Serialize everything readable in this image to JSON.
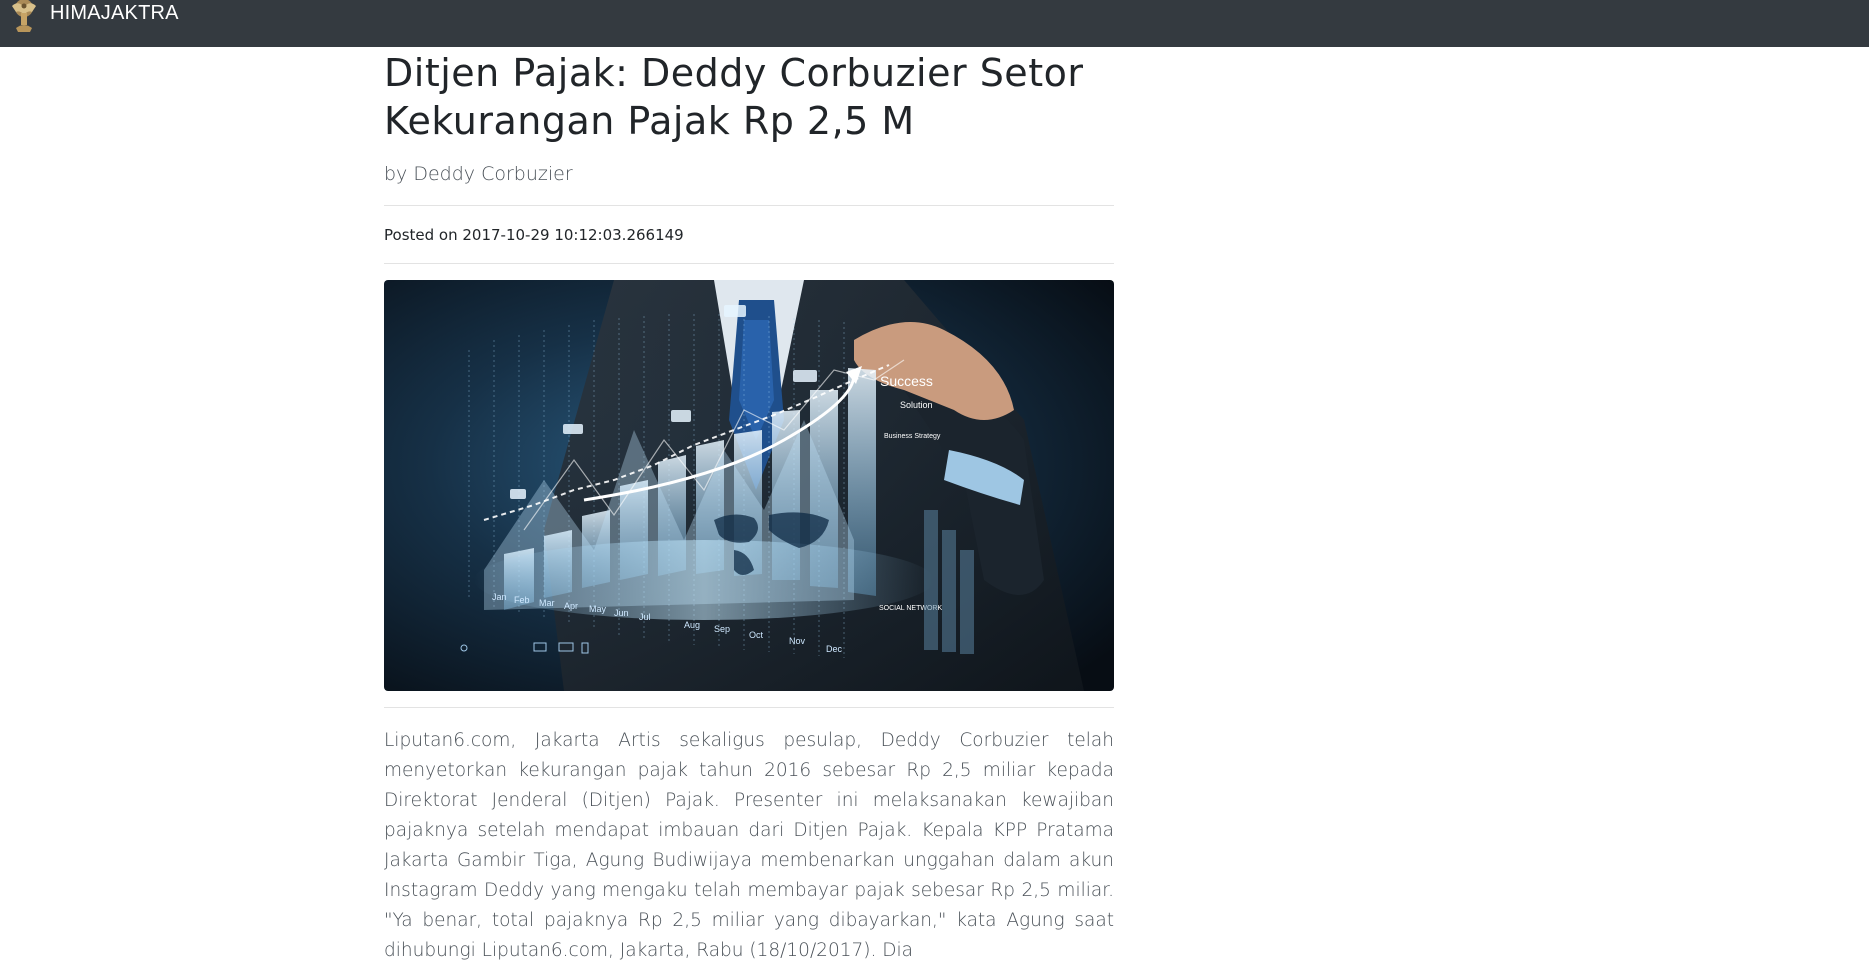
{
  "navbar": {
    "brand_name": "HIMAJAKTRA",
    "logo_icon": "eagle-emblem-icon",
    "background": "#343a40"
  },
  "post": {
    "title": "Ditjen Pajak: Deddy Corbuzier Setor Kekurangan Pajak Rp 2,5 M",
    "by_prefix": "by",
    "author": "Deddy Corbuzier",
    "posted_prefix": "Posted on",
    "posted_datetime": "2017-10-29 10:12:03.266149",
    "hero_image": {
      "kind": "business-growth-chart-illustration",
      "labels": [
        "Success",
        "Solution",
        "Business Strategy",
        "SOCIAL NETWORK"
      ],
      "months": [
        "Jan",
        "Feb",
        "Mar",
        "Apr",
        "May",
        "Jun",
        "Jul",
        "Aug",
        "Sep",
        "Oct",
        "Nov",
        "Dec"
      ]
    },
    "body": "Liputan6.com, Jakarta Artis sekaligus pesulap, Deddy Corbuzier telah menyetorkan kekurangan pajak tahun 2016 sebesar Rp 2,5 miliar kepada Direktorat Jenderal (Ditjen) Pajak. Presenter ini melaksanakan kewajiban pajaknya setelah mendapat imbauan dari Ditjen Pajak. Kepala KPP Pratama Jakarta Gambir Tiga, Agung Budiwijaya membenarkan unggahan dalam akun Instagram Deddy yang mengaku telah membayar pajak sebesar Rp 2,5 miliar. \"Ya benar, total pajaknya Rp 2,5 miliar yang dibayarkan,\" kata Agung saat dihubungi Liputan6.com, Jakarta, Rabu (18/10/2017). Dia"
  }
}
